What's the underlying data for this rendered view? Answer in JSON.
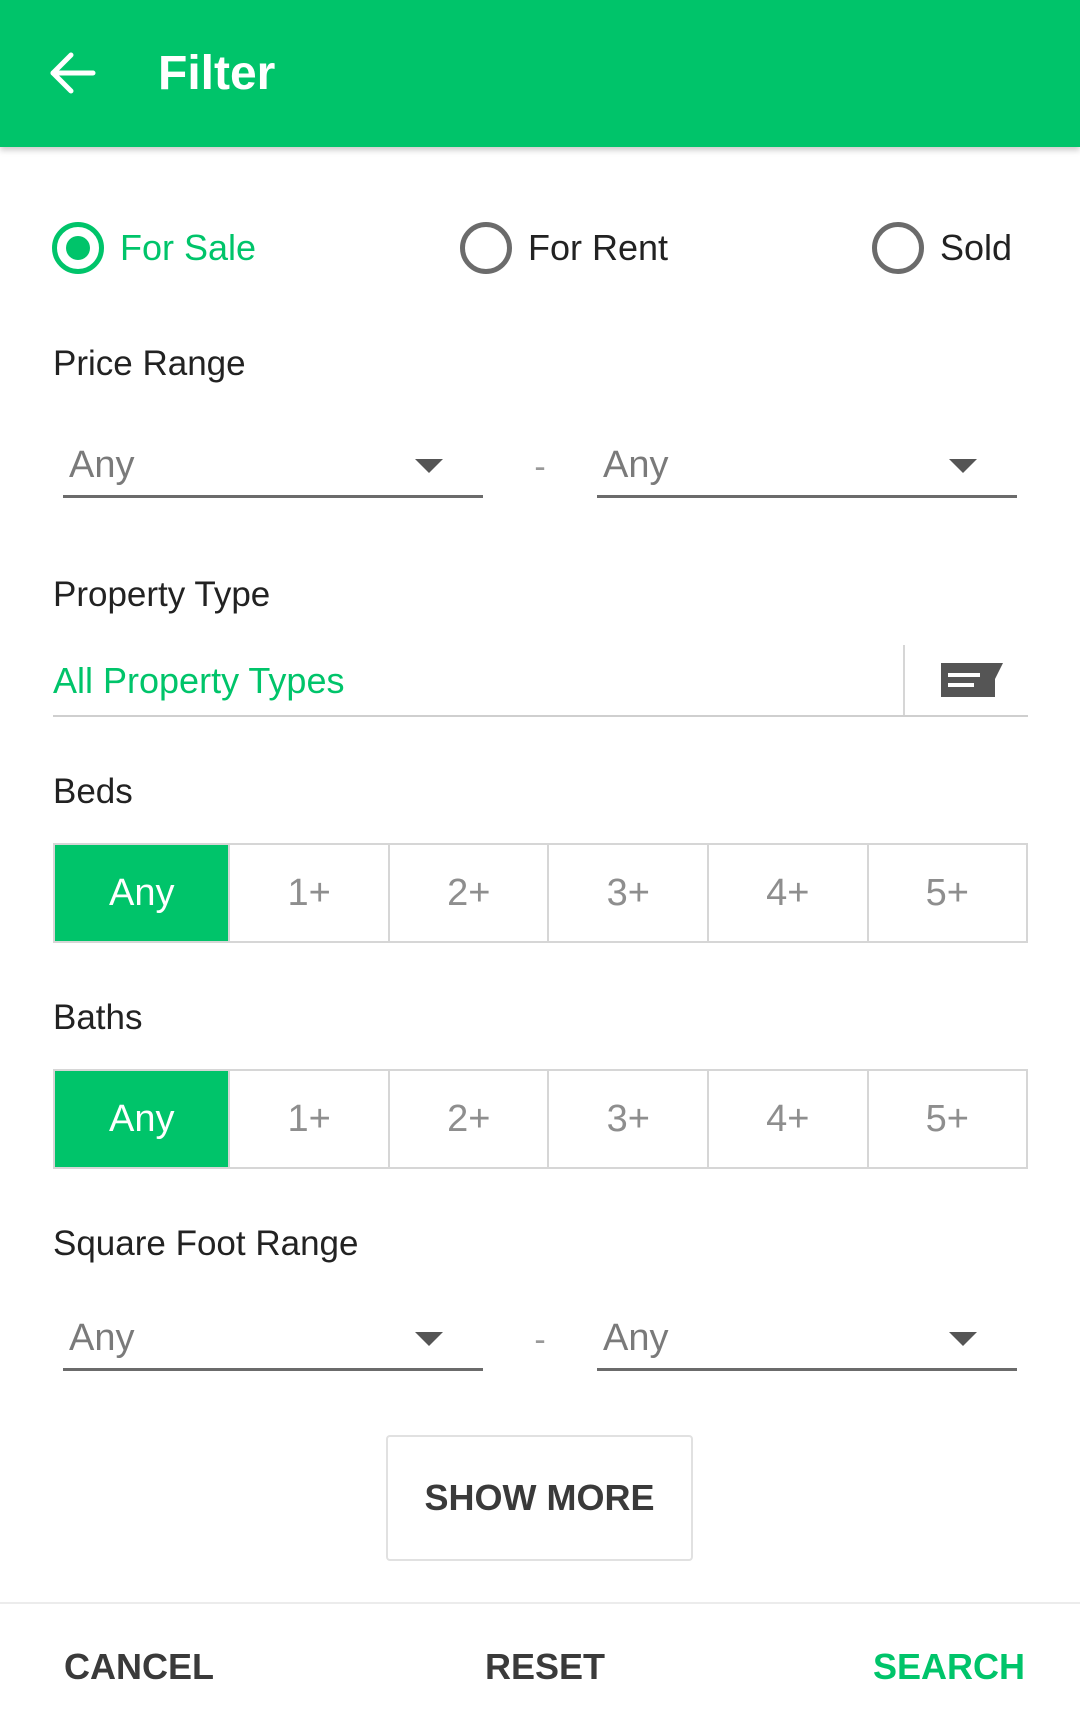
{
  "appbar": {
    "title": "Filter",
    "back_icon": "arrow-back-icon"
  },
  "listing_status": {
    "options": [
      {
        "label": "For Sale",
        "checked": true
      },
      {
        "label": "For Rent",
        "checked": false
      },
      {
        "label": "Sold",
        "checked": false
      }
    ]
  },
  "price_range": {
    "label": "Price Range",
    "min": "Any",
    "max": "Any",
    "separator": "-"
  },
  "property_type": {
    "label": "Property Type",
    "value": "All Property Types",
    "icon": "list-picker-icon"
  },
  "beds": {
    "label": "Beds",
    "options": [
      "Any",
      "1+",
      "2+",
      "3+",
      "4+",
      "5+"
    ],
    "selected": "Any"
  },
  "baths": {
    "label": "Baths",
    "options": [
      "Any",
      "1+",
      "2+",
      "3+",
      "4+",
      "5+"
    ],
    "selected": "Any"
  },
  "square_foot_range": {
    "label": "Square Foot Range",
    "min": "Any",
    "max": "Any",
    "separator": "-"
  },
  "show_more_label": "SHOW MORE",
  "footer": {
    "cancel": "CANCEL",
    "reset": "RESET",
    "search": "SEARCH"
  },
  "colors": {
    "accent": "#00c46a",
    "text": "#222222",
    "muted": "#7a7a7a"
  }
}
